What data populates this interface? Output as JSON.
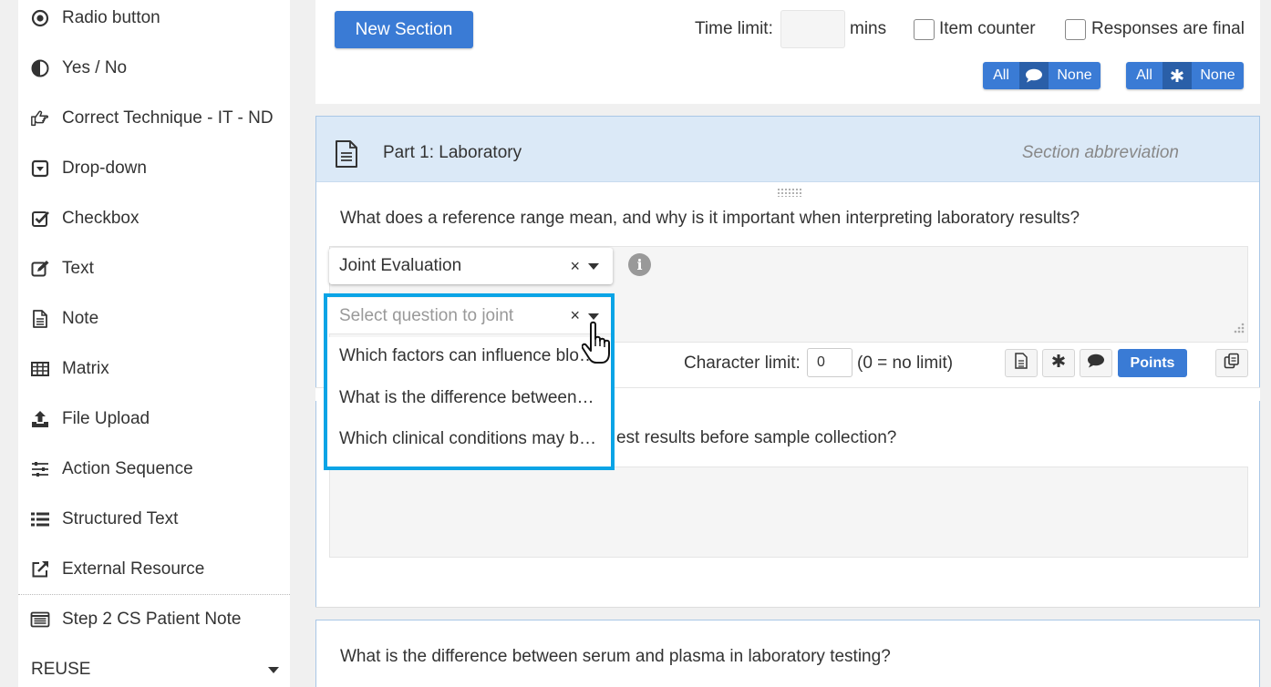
{
  "sidebar": {
    "items": [
      {
        "label": "Radio button",
        "icon": "radio-icon"
      },
      {
        "label": "Yes / No",
        "icon": "half-circle-icon"
      },
      {
        "label": "Correct Technique - IT - ND",
        "icon": "hand-point-icon"
      },
      {
        "label": "Drop-down",
        "icon": "dropdown-icon"
      },
      {
        "label": "Checkbox",
        "icon": "checkbox-icon"
      },
      {
        "label": "Text",
        "icon": "edit-icon"
      },
      {
        "label": "Note",
        "icon": "note-icon"
      },
      {
        "label": "Matrix",
        "icon": "table-icon"
      },
      {
        "label": "File Upload",
        "icon": "upload-icon"
      },
      {
        "label": "Action Sequence",
        "icon": "sliders-icon"
      },
      {
        "label": "Structured Text",
        "icon": "list-icon"
      },
      {
        "label": "External Resource",
        "icon": "external-link-icon"
      },
      {
        "label": "Step 2 CS Patient Note",
        "icon": "patient-note-icon"
      }
    ],
    "reuse_label": "REUSE"
  },
  "top": {
    "new_section": "New Section",
    "time_limit_label": "Time limit:",
    "mins_label": "mins",
    "item_counter": "Item counter",
    "responses_final": "Responses are final",
    "seg1": {
      "all": "All",
      "none": "None",
      "icon": "comment-icon"
    },
    "seg2": {
      "all": "All",
      "none": "None",
      "icon": "asterisk-icon"
    }
  },
  "section": {
    "title": "Part 1: Laboratory",
    "abbreviation_placeholder": "Section abbreviation",
    "q1": "What does a reference range mean, and why is it important when interpreting laboratory results?",
    "joint_select": "Joint Evaluation",
    "joint_question_placeholder": "Select question to joint",
    "clear_x": "×",
    "info": "i",
    "char_limit_label": "Character limit:",
    "char_limit_value": "0",
    "char_limit_hint": "(0 = no limit)",
    "points": "Points",
    "q2_partial": "est results before sample collection?",
    "q3": "What is the difference between serum and plasma in laboratory testing?"
  },
  "dropdown": {
    "options": [
      "Which factors can influence blo…",
      "What is the difference between…",
      "Which clinical conditions may b…"
    ]
  },
  "colors": {
    "primary": "#3a7bd5",
    "highlight": "#0aa4e6",
    "section_header": "#dbe9f7"
  }
}
